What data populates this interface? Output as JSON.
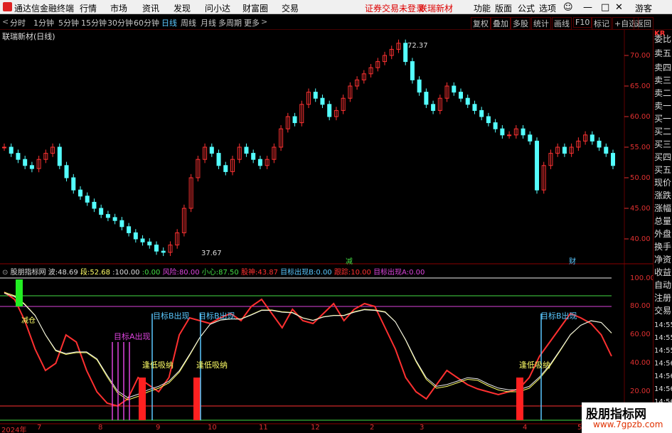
{
  "menubar": {
    "app_name": "通达信金融终端",
    "menus": [
      "行情",
      "市场",
      "资讯",
      "发现",
      "问小达",
      "财富圈",
      "交易"
    ],
    "status_text": "证券交易未登录",
    "stock_name": "联瑞新材",
    "right_menus": [
      "功能",
      "版面",
      "公式",
      "选项"
    ],
    "guest": "游客"
  },
  "toolbar": {
    "periods": [
      "分时",
      "1分钟",
      "5分钟",
      "15分钟",
      "30分钟",
      "60分钟",
      "日线",
      "周线",
      "月线",
      "多周期",
      "更多"
    ],
    "active_period": "日线",
    "tools": [
      "复权",
      "叠加",
      "多股",
      "统计",
      "画线",
      "F10",
      "标记",
      "+自选",
      "返回"
    ]
  },
  "main_chart": {
    "title": "联瑞新材(日线)",
    "high_label": "72.37",
    "low_label": "37.67",
    "y_ticks": [
      "70.00",
      "65.00",
      "60.00",
      "55.00",
      "50.00",
      "45.00",
      "40.00"
    ],
    "markers": [
      {
        "text": "减",
        "color": "#44dd44"
      },
      {
        "text": "财",
        "color": "#5ac8ff"
      }
    ]
  },
  "indicator": {
    "name": "股朋指标网",
    "values": [
      {
        "label": "波:",
        "value": "48.69",
        "color": "#dddddd"
      },
      {
        "label": "段:",
        "value": "52.68",
        "color": "#ffff66"
      },
      {
        "label": ":",
        "value": "100.00",
        "color": "#dddddd"
      },
      {
        "label": ":",
        "value": "0.00",
        "color": "#44dd44"
      },
      {
        "label": "风险:",
        "value": "80.00",
        "color": "#dd44dd"
      },
      {
        "label": "小心:",
        "value": "87.50",
        "color": "#44dd44"
      },
      {
        "label": "股神:",
        "value": "43.87",
        "color": "#ff3030"
      },
      {
        "label": "目标出现B:",
        "value": "0.00",
        "color": "#5ac8ff"
      },
      {
        "label": "跟踪:",
        "value": "10.00",
        "color": "#ff3030"
      },
      {
        "label": "目标出现A:",
        "value": "0.00",
        "color": "#dd44dd"
      }
    ],
    "y_ticks": [
      "100.00",
      "80.00",
      "60.00",
      "40.00",
      "20.00"
    ],
    "annotations": [
      {
        "text": "减仓",
        "color": "#ffff66"
      },
      {
        "text": "目标B出现",
        "color": "#5ac8ff"
      },
      {
        "text": "目标B出现",
        "color": "#5ac8ff"
      },
      {
        "text": "目标B出现",
        "color": "#5ac8ff"
      },
      {
        "text": "目标A出现",
        "color": "#dd44dd"
      },
      {
        "text": "逢低吸纳",
        "color": "#ffff66"
      },
      {
        "text": "逢低吸纳",
        "color": "#ffff66"
      },
      {
        "text": "逢低吸纳",
        "color": "#ffff66"
      }
    ]
  },
  "x_axis": [
    "2024年",
    "7",
    "8",
    "9",
    "10",
    "11",
    "12",
    "2",
    "3",
    "4",
    "5"
  ],
  "right_panel": {
    "code": "KR",
    "items": [
      "委比",
      "卖五",
      "卖四",
      "卖三",
      "卖二",
      "卖一",
      "买一",
      "买二",
      "买三",
      "买四",
      "买五",
      "现价",
      "涨跌",
      "涨幅",
      "总量",
      "外盘",
      "换手",
      "净资",
      "收益",
      "自动",
      "注册",
      "交易"
    ],
    "times": [
      "14:55",
      "14:55",
      "14:55",
      "14:56",
      "14:56",
      "14:56",
      "14:56"
    ]
  },
  "watermark": {
    "title": "股朋指标网",
    "url": "www.7gpzb.com"
  },
  "colors": {
    "up": "#ff3232",
    "down": "#54ffff",
    "axis": "#e03030",
    "grid": "#600000"
  }
}
